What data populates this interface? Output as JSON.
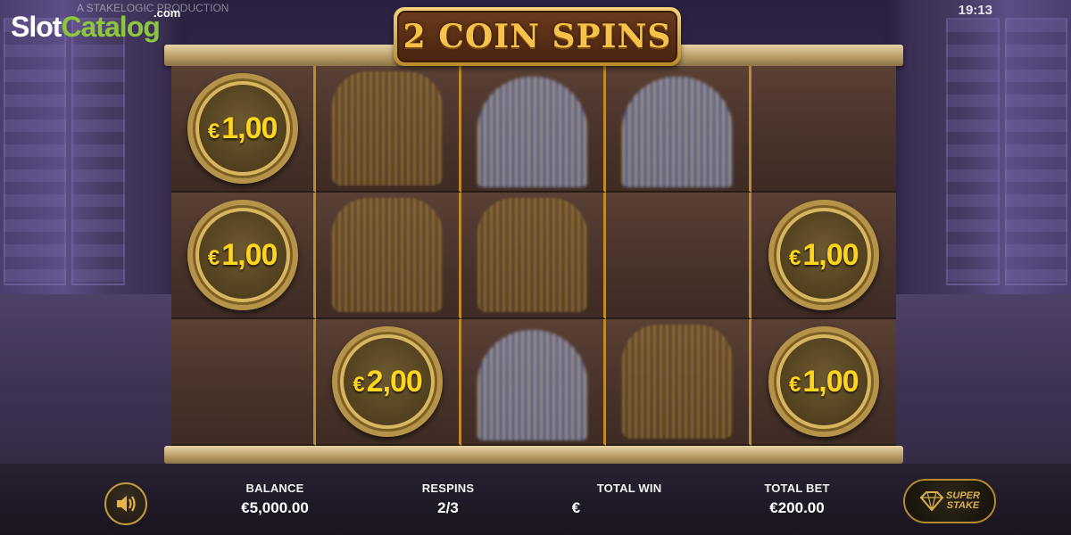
{
  "watermark": {
    "brand_white": "Slot",
    "brand_green": "Catalog",
    "brand_com": ".com",
    "production": "A STAKELOGIC  PRODUCTION"
  },
  "clock": "19:13",
  "title": "2 COIN SPINS",
  "reels": [
    [
      {
        "type": "coin",
        "currency": "€",
        "amount": "1,00"
      },
      {
        "type": "blur-gold"
      },
      {
        "type": "blur-blue"
      },
      {
        "type": "blur-blue"
      },
      {
        "type": "empty"
      }
    ],
    [
      {
        "type": "coin",
        "currency": "€",
        "amount": "1,00"
      },
      {
        "type": "blur-gold"
      },
      {
        "type": "blur-gold"
      },
      {
        "type": "empty"
      },
      {
        "type": "coin",
        "currency": "€",
        "amount": "1,00"
      }
    ],
    [
      {
        "type": "empty"
      },
      {
        "type": "coin",
        "currency": "€",
        "amount": "2,00"
      },
      {
        "type": "blur-blue"
      },
      {
        "type": "blur-gold"
      },
      {
        "type": "coin",
        "currency": "€",
        "amount": "1,00"
      }
    ]
  ],
  "bottom_bar": {
    "balance_label": "BALANCE",
    "balance_value": "€5,000.00",
    "respins_label": "RESPINS",
    "respins_value": "2/3",
    "total_win_label": "TOTAL WIN",
    "total_win_value": "€",
    "total_bet_label": "TOTAL BET",
    "total_bet_value": "€200.00",
    "super_stake_label_1": "SUPER",
    "super_stake_label_2": "STAKE"
  },
  "icons": {
    "sound": "speaker-icon",
    "super_stake": "diamond-icon"
  },
  "colors": {
    "coin_text": "#ffd51e",
    "title_text": "#f6c24a",
    "frame_gold": "#c08a2a"
  }
}
